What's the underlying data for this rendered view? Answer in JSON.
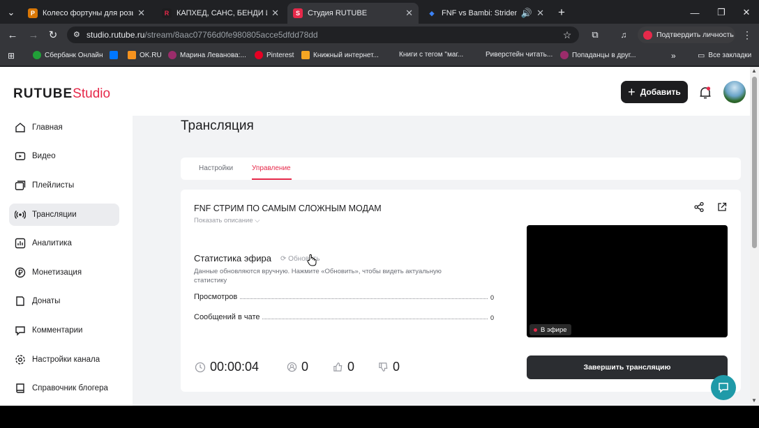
{
  "browser": {
    "tabs": [
      {
        "title": "Колесо фортуны для розыгры",
        "color": "#d97706",
        "glyph": "P"
      },
      {
        "title": "КАПХЕД, САНС, БЕНДИ И КАК",
        "color": "#1d1d1f",
        "glyph": "R"
      },
      {
        "title": "Студия RUTUBE",
        "color": "#e6294a",
        "glyph": "S"
      },
      {
        "title": "FNF vs Bambi: Strident Crisis",
        "color": "#3b82f6",
        "glyph": "◆"
      }
    ],
    "url_host": "studio.rutube.ru",
    "url_path": "/stream/8aac07766d0fe980805acce5dfdd78dd",
    "verify_label": "Подтвердить личность",
    "bookmarks": [
      {
        "label": "Сбербанк Онлайн",
        "color": "#21a038"
      },
      {
        "label": "OK.RU",
        "color": "#f7931e"
      },
      {
        "label": "Марина Леванова:...",
        "color": "#9b2c6b"
      },
      {
        "label": "Pinterest",
        "color": "#e60023"
      },
      {
        "label": "Книжный интернет...",
        "color": "#f5a623"
      },
      {
        "label": "Книги с тегом \"маг...",
        "color": "#35363a"
      },
      {
        "label": "Риверстейн читать...",
        "color": "#35363a"
      },
      {
        "label": "Попаданцы в друг...",
        "color": "#9b2c6b"
      }
    ],
    "all_bookmarks": "Все закладки"
  },
  "app": {
    "logo_main": "RUTUBE",
    "logo_studio": "Studio",
    "add_label": "Добавить",
    "accent": "#e6294a"
  },
  "sidebar": {
    "items": [
      {
        "label": "Главная",
        "icon": "home-icon"
      },
      {
        "label": "Видео",
        "icon": "video-icon"
      },
      {
        "label": "Плейлисты",
        "icon": "playlist-icon"
      },
      {
        "label": "Трансляции",
        "icon": "broadcast-icon"
      },
      {
        "label": "Аналитика",
        "icon": "analytics-icon"
      },
      {
        "label": "Монетизация",
        "icon": "monetization-icon"
      },
      {
        "label": "Донаты",
        "icon": "donate-icon"
      },
      {
        "label": "Комментарии",
        "icon": "comments-icon"
      },
      {
        "label": "Настройки канала",
        "icon": "gear-icon"
      },
      {
        "label": "Справочник блогера",
        "icon": "book-icon"
      }
    ]
  },
  "main": {
    "title": "Трансляция",
    "tabs": [
      {
        "label": "Настройки"
      },
      {
        "label": "Управление"
      }
    ],
    "stream_title": "FNF СТРИМ ПО САМЫМ СЛОЖНЫМ МОДАМ",
    "show_description": "Показать описание",
    "stats_title": "Статистика эфира",
    "refresh_label": "Обновить",
    "stats_note": "Данные обновляются вручную. Нажмите «Обновить», чтобы видеть актуальную статистику",
    "stats": [
      {
        "label": "Просмотров",
        "value": "0"
      },
      {
        "label": "Сообщений в чате",
        "value": "0"
      }
    ],
    "timer": "00:00:04",
    "viewers": "0",
    "likes": "0",
    "dislikes": "0",
    "live_label": "В эфире",
    "end_label": "Завершить трансляцию"
  }
}
